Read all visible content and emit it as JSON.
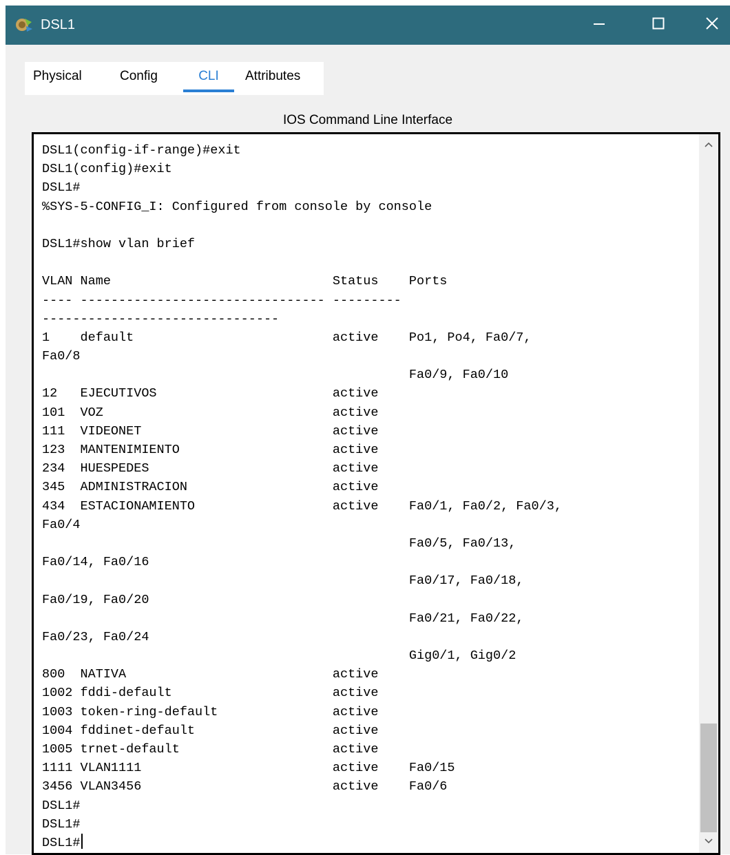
{
  "window": {
    "title": "DSL1",
    "icon": "packet-tracer-device-icon",
    "controls": [
      "minimize-icon",
      "maximize-icon",
      "close-icon"
    ]
  },
  "tabs": [
    {
      "label": "Physical",
      "active": false
    },
    {
      "label": "Config",
      "active": false
    },
    {
      "label": "CLI",
      "active": true
    },
    {
      "label": "Attributes",
      "active": false
    }
  ],
  "section_title": "IOS Command Line Interface",
  "terminal": {
    "lines": [
      "DSL1(config-if-range)#exit",
      "DSL1(config)#exit",
      "DSL1#",
      "%SYS-5-CONFIG_I: Configured from console by console",
      "",
      "DSL1#show vlan brief",
      "",
      "VLAN Name                             Status    Ports",
      "---- -------------------------------- ---------",
      "-------------------------------",
      "1    default                          active    Po1, Po4, Fa0/7,",
      "Fa0/8",
      "                                                Fa0/9, Fa0/10",
      "12   EJECUTIVOS                       active",
      "101  VOZ                              active",
      "111  VIDEONET                         active",
      "123  MANTENIMIENTO                    active",
      "234  HUESPEDES                        active",
      "345  ADMINISTRACION                   active",
      "434  ESTACIONAMIENTO                  active    Fa0/1, Fa0/2, Fa0/3,",
      "Fa0/4",
      "                                                Fa0/5, Fa0/13,",
      "Fa0/14, Fa0/16",
      "                                                Fa0/17, Fa0/18,",
      "Fa0/19, Fa0/20",
      "                                                Fa0/21, Fa0/22,",
      "Fa0/23, Fa0/24",
      "                                                Gig0/1, Gig0/2",
      "800  NATIVA                           active",
      "1002 fddi-default                     active",
      "1003 token-ring-default               active",
      "1004 fddinet-default                  active",
      "1005 trnet-default                    active",
      "1111 VLAN1111                         active    Fa0/15",
      "3456 VLAN3456                         active    Fa0/6",
      "DSL1#",
      "DSL1#",
      "DSL1#"
    ]
  },
  "colors": {
    "titlebar": "#2d6b7d",
    "active_tab": "#2a7fd4"
  }
}
